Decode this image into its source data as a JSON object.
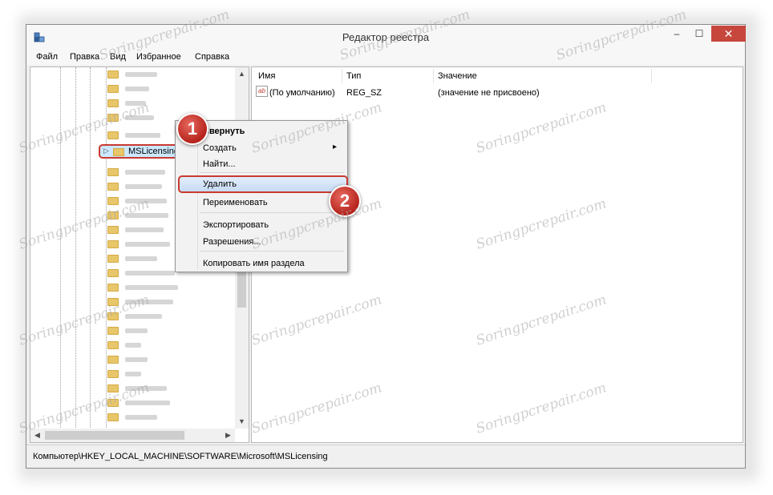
{
  "window": {
    "title": "Редактор реестра",
    "controls": {
      "minimize": "–",
      "maximize": "☐",
      "close": "✕"
    }
  },
  "menu": {
    "items": [
      "Файл",
      "Правка",
      "Вид",
      "Избранное",
      "Справка"
    ]
  },
  "tree": {
    "selected_node": "MSLicensing",
    "expander": "▷"
  },
  "values": {
    "columns": [
      "Имя",
      "Тип",
      "Значение"
    ],
    "rows": [
      {
        "icon": "ab",
        "name": "(По умолчанию)",
        "type": "REG_SZ",
        "value": "(значение не присвоено)"
      }
    ]
  },
  "context_menu": {
    "items": {
      "collapse": "Свернуть",
      "create": "Создать",
      "find": "Найти...",
      "delete": "Удалить",
      "rename": "Переименовать",
      "export": "Экспортировать",
      "permissions": "Разрешения...",
      "copy_key_name": "Копировать имя раздела"
    },
    "submenu_arrow": "▸"
  },
  "badges": {
    "step1": "1",
    "step2": "2"
  },
  "status_bar": {
    "path": "Компьютер\\HKEY_LOCAL_MACHINE\\SOFTWARE\\Microsoft\\MSLicensing"
  },
  "watermark": "Soringpcrepair.com",
  "colors": {
    "highlight_border": "#c93a30",
    "badge_red": "#c0392b",
    "close_button": "#c7473d",
    "selection": "#cce8ff"
  }
}
